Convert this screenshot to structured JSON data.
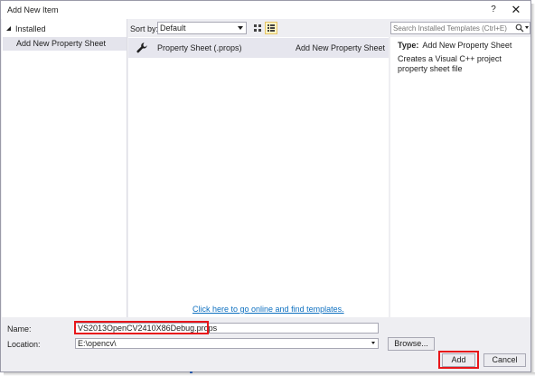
{
  "window": {
    "title": "Add New Item",
    "help_label": "?",
    "close_label": "✕"
  },
  "left_panel": {
    "root_label": "Installed",
    "items": [
      {
        "label": "Add New Property Sheet",
        "selected": true
      }
    ]
  },
  "toolbar": {
    "sort_label": "Sort by:",
    "sort_value": "Default",
    "view_icons": [
      "grid-view-icon",
      "list-view-icon"
    ]
  },
  "templates": [
    {
      "icon": "wrench-icon",
      "name": "Property Sheet (.props)",
      "language": "Add New Property Sheet",
      "selected": true
    }
  ],
  "online_link": "Click here to go online and find templates.",
  "search": {
    "placeholder": "Search Installed Templates (Ctrl+E)",
    "icon": "search-icon"
  },
  "details": {
    "type_label": "Type:",
    "type_value": "Add New Property Sheet",
    "description": "Creates a Visual C++ project property sheet file"
  },
  "form": {
    "name_label": "Name:",
    "name_value": "VS2013OpenCV2410X86Debug.props",
    "location_label": "Location:",
    "location_value": "E:\\opencv\\",
    "browse_label": "Browse...",
    "add_label": "Add",
    "cancel_label": "Cancel"
  },
  "colors": {
    "highlight_box": "#e8161a",
    "link": "#0e70c0",
    "selection": "#e4e4ec"
  }
}
